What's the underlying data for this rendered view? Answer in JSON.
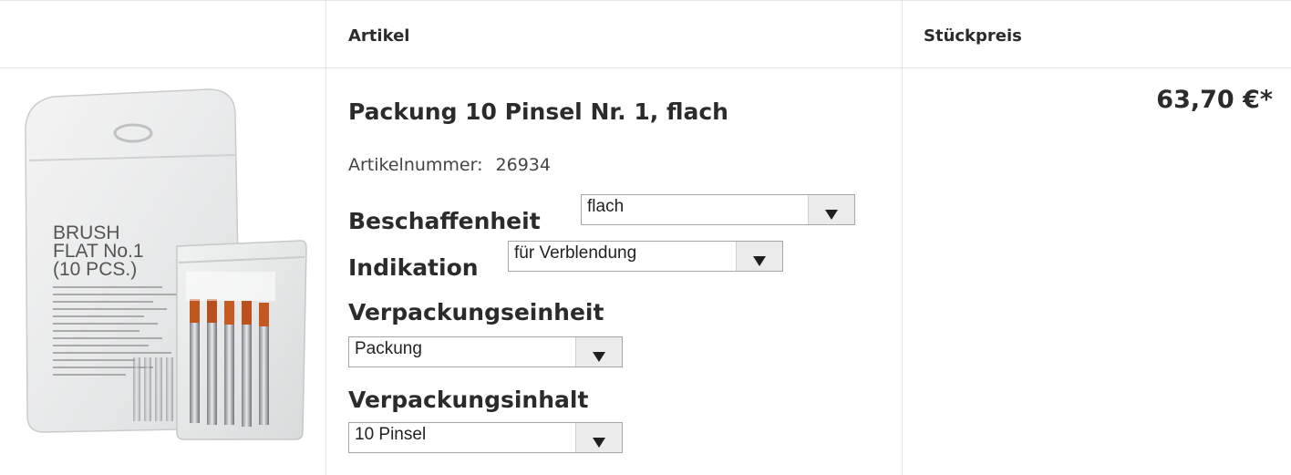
{
  "header": {
    "col_article": "Artikel",
    "col_unit_price": "Stückpreis"
  },
  "product": {
    "title": "Packung 10 Pinsel Nr. 1, flach",
    "article_number_label": "Artikelnummer:",
    "article_number": "26934",
    "image": {
      "bag_print_line1": "BRUSH",
      "bag_print_line2": "FLAT No.1",
      "bag_print_line3": "(10 PCS.)"
    },
    "options": [
      {
        "label": "Beschaffenheit",
        "value": "flach"
      },
      {
        "label": "Indikation",
        "value": "für Verblendung"
      },
      {
        "label": "Verpackungseinheit",
        "value": "Packung"
      },
      {
        "label": "Verpackungsinhalt",
        "value": "10 Pinsel"
      }
    ],
    "price": "63,70 €*"
  },
  "colors": {
    "border": "#e3e6ea",
    "text": "#2b2b2b",
    "select_border": "#a6a6a6",
    "select_button": "#ebebeb"
  }
}
